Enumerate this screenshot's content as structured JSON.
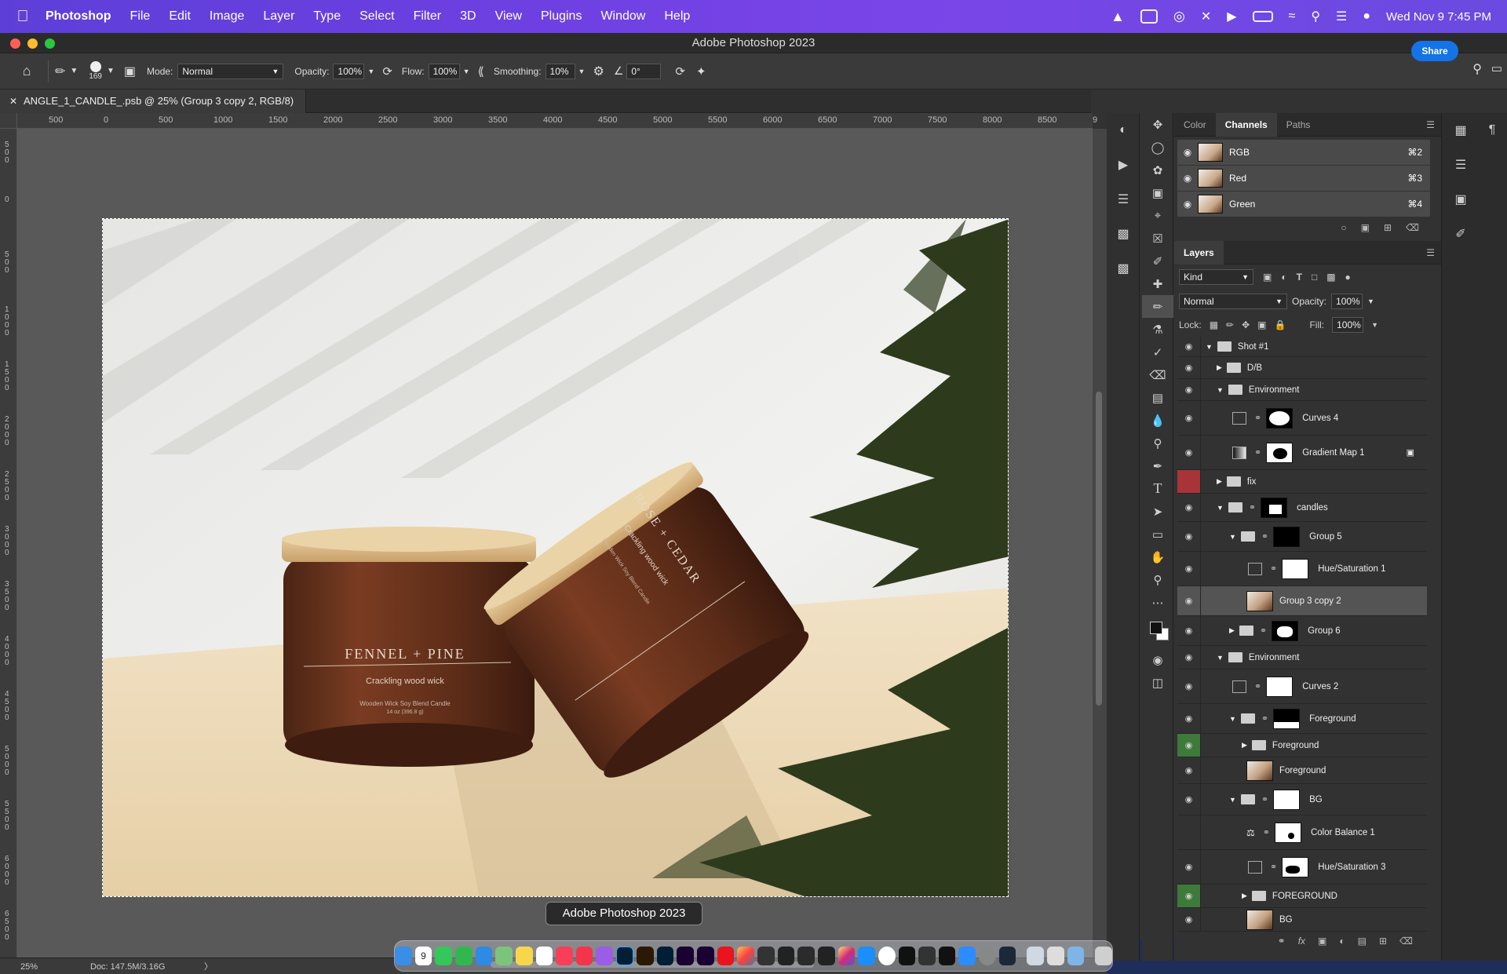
{
  "menubar": {
    "app_name": "Photoshop",
    "items": [
      "File",
      "Edit",
      "Image",
      "Layer",
      "Type",
      "Select",
      "Filter",
      "3D",
      "View",
      "Plugins",
      "Window",
      "Help"
    ],
    "datetime": "Wed Nov 9  7:45 PM"
  },
  "window": {
    "title": "Adobe Photoshop 2023"
  },
  "options": {
    "brush_size": "169",
    "mode_label": "Mode:",
    "mode_value": "Normal",
    "opacity_label": "Opacity:",
    "opacity_value": "100%",
    "flow_label": "Flow:",
    "flow_value": "100%",
    "smoothing_label": "Smoothing:",
    "smoothing_value": "10%",
    "angle_value": "0°",
    "share_label": "Share"
  },
  "document": {
    "tab_title": "ANGLE_1_CANDLE_.psb @ 25% (Group 3 copy 2, RGB/8)"
  },
  "ruler": {
    "h_labels": [
      "500",
      "0",
      "500",
      "1000",
      "1500",
      "2000",
      "2500",
      "3000",
      "3500",
      "4000",
      "4500",
      "5000",
      "5500",
      "6000",
      "6500",
      "7000",
      "7500",
      "8000",
      "8500",
      "9"
    ],
    "v_labels": [
      "5\n0\n0",
      "0",
      "5\n0\n0",
      "1\n0\n0\n0",
      "1\n5\n0\n0",
      "2\n0\n0\n0",
      "2\n5\n0\n0",
      "3\n0\n0\n0",
      "3\n5\n0\n0",
      "4\n0\n0\n0",
      "4\n5\n0\n0",
      "5\n0\n0\n0",
      "5\n5\n0\n0",
      "6\n0\n0\n0",
      "6\n5\n0\n0"
    ]
  },
  "status": {
    "zoom": "25%",
    "doc": "Doc: 147.5M/3.16G",
    "arrow": "〉"
  },
  "photo": {
    "jar1_title": "FENNEL + PINE",
    "jar1_sub": "Crackling wood wick",
    "jar1_small": "Wooden Wick Soy Blend Candle",
    "jar1_weight": "14 oz (396.8 g)",
    "jar2_title": "ROSE + CEDAR",
    "jar2_sub": "Crackling wood wick",
    "jar2_small": "Wooden Wick Soy Blend Candle"
  },
  "channels_panel": {
    "tabs": [
      "Color",
      "Channels",
      "Paths"
    ],
    "active_tab": "Channels",
    "rows": [
      {
        "name": "RGB",
        "shortcut": "⌘2"
      },
      {
        "name": "Red",
        "shortcut": "⌘3"
      },
      {
        "name": "Green",
        "shortcut": "⌘4"
      }
    ]
  },
  "layers_panel": {
    "title": "Layers",
    "filter_kind": "Kind",
    "blend_mode": "Normal",
    "opacity_label": "Opacity:",
    "opacity_value": "100%",
    "lock_label": "Lock:",
    "fill_label": "Fill:",
    "fill_value": "100%",
    "layers": [
      {
        "name": "Shot #1",
        "eye": "on"
      },
      {
        "name": "D/B",
        "eye": "on"
      },
      {
        "name": "Environment",
        "eye": "on"
      },
      {
        "name": "Curves 4",
        "eye": "on"
      },
      {
        "name": "Gradient Map 1",
        "eye": "on"
      },
      {
        "name": "fix",
        "eye": "red"
      },
      {
        "name": "candles",
        "eye": "on"
      },
      {
        "name": "Group 5",
        "eye": "on"
      },
      {
        "name": "Hue/Saturation 1",
        "eye": "on"
      },
      {
        "name": "Group 3 copy 2",
        "eye": "on"
      },
      {
        "name": "Group 6",
        "eye": "on"
      },
      {
        "name": "Environment",
        "eye": "on"
      },
      {
        "name": "Curves 2",
        "eye": "on"
      },
      {
        "name": "Foreground",
        "eye": "on"
      },
      {
        "name": "Foreground",
        "eye": "green"
      },
      {
        "name": "Foreground",
        "eye": "on"
      },
      {
        "name": "BG",
        "eye": "on"
      },
      {
        "name": "Color Balance 1",
        "eye": "off"
      },
      {
        "name": "Hue/Saturation 3",
        "eye": "on"
      },
      {
        "name": "FOREGROUND",
        "eye": "green"
      },
      {
        "name": "BG",
        "eye": "on"
      }
    ]
  },
  "tooltip": {
    "text": "Adobe Photoshop 2023"
  },
  "dock": {
    "calendar_day": "9"
  },
  "colors": {
    "share": "#1473e6",
    "menubar": "#6b3fe0",
    "selected_row": "#545454",
    "red_eye": "#a8343a",
    "green_eye": "#3d7a3b"
  }
}
